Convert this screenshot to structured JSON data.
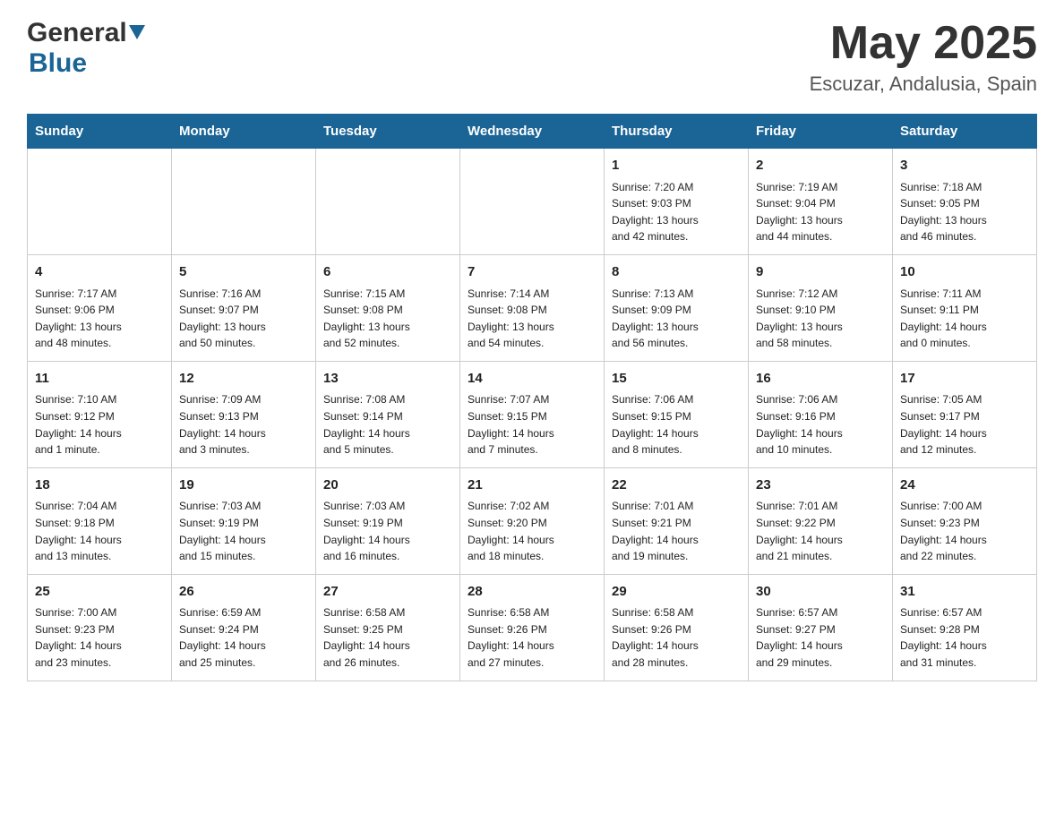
{
  "header": {
    "month_year": "May 2025",
    "location": "Escuzar, Andalusia, Spain",
    "logo_general": "General",
    "logo_blue": "Blue"
  },
  "days_of_week": [
    "Sunday",
    "Monday",
    "Tuesday",
    "Wednesday",
    "Thursday",
    "Friday",
    "Saturday"
  ],
  "weeks": [
    {
      "days": [
        {
          "num": "",
          "info": ""
        },
        {
          "num": "",
          "info": ""
        },
        {
          "num": "",
          "info": ""
        },
        {
          "num": "",
          "info": ""
        },
        {
          "num": "1",
          "info": "Sunrise: 7:20 AM\nSunset: 9:03 PM\nDaylight: 13 hours\nand 42 minutes."
        },
        {
          "num": "2",
          "info": "Sunrise: 7:19 AM\nSunset: 9:04 PM\nDaylight: 13 hours\nand 44 minutes."
        },
        {
          "num": "3",
          "info": "Sunrise: 7:18 AM\nSunset: 9:05 PM\nDaylight: 13 hours\nand 46 minutes."
        }
      ]
    },
    {
      "days": [
        {
          "num": "4",
          "info": "Sunrise: 7:17 AM\nSunset: 9:06 PM\nDaylight: 13 hours\nand 48 minutes."
        },
        {
          "num": "5",
          "info": "Sunrise: 7:16 AM\nSunset: 9:07 PM\nDaylight: 13 hours\nand 50 minutes."
        },
        {
          "num": "6",
          "info": "Sunrise: 7:15 AM\nSunset: 9:08 PM\nDaylight: 13 hours\nand 52 minutes."
        },
        {
          "num": "7",
          "info": "Sunrise: 7:14 AM\nSunset: 9:08 PM\nDaylight: 13 hours\nand 54 minutes."
        },
        {
          "num": "8",
          "info": "Sunrise: 7:13 AM\nSunset: 9:09 PM\nDaylight: 13 hours\nand 56 minutes."
        },
        {
          "num": "9",
          "info": "Sunrise: 7:12 AM\nSunset: 9:10 PM\nDaylight: 13 hours\nand 58 minutes."
        },
        {
          "num": "10",
          "info": "Sunrise: 7:11 AM\nSunset: 9:11 PM\nDaylight: 14 hours\nand 0 minutes."
        }
      ]
    },
    {
      "days": [
        {
          "num": "11",
          "info": "Sunrise: 7:10 AM\nSunset: 9:12 PM\nDaylight: 14 hours\nand 1 minute."
        },
        {
          "num": "12",
          "info": "Sunrise: 7:09 AM\nSunset: 9:13 PM\nDaylight: 14 hours\nand 3 minutes."
        },
        {
          "num": "13",
          "info": "Sunrise: 7:08 AM\nSunset: 9:14 PM\nDaylight: 14 hours\nand 5 minutes."
        },
        {
          "num": "14",
          "info": "Sunrise: 7:07 AM\nSunset: 9:15 PM\nDaylight: 14 hours\nand 7 minutes."
        },
        {
          "num": "15",
          "info": "Sunrise: 7:06 AM\nSunset: 9:15 PM\nDaylight: 14 hours\nand 8 minutes."
        },
        {
          "num": "16",
          "info": "Sunrise: 7:06 AM\nSunset: 9:16 PM\nDaylight: 14 hours\nand 10 minutes."
        },
        {
          "num": "17",
          "info": "Sunrise: 7:05 AM\nSunset: 9:17 PM\nDaylight: 14 hours\nand 12 minutes."
        }
      ]
    },
    {
      "days": [
        {
          "num": "18",
          "info": "Sunrise: 7:04 AM\nSunset: 9:18 PM\nDaylight: 14 hours\nand 13 minutes."
        },
        {
          "num": "19",
          "info": "Sunrise: 7:03 AM\nSunset: 9:19 PM\nDaylight: 14 hours\nand 15 minutes."
        },
        {
          "num": "20",
          "info": "Sunrise: 7:03 AM\nSunset: 9:19 PM\nDaylight: 14 hours\nand 16 minutes."
        },
        {
          "num": "21",
          "info": "Sunrise: 7:02 AM\nSunset: 9:20 PM\nDaylight: 14 hours\nand 18 minutes."
        },
        {
          "num": "22",
          "info": "Sunrise: 7:01 AM\nSunset: 9:21 PM\nDaylight: 14 hours\nand 19 minutes."
        },
        {
          "num": "23",
          "info": "Sunrise: 7:01 AM\nSunset: 9:22 PM\nDaylight: 14 hours\nand 21 minutes."
        },
        {
          "num": "24",
          "info": "Sunrise: 7:00 AM\nSunset: 9:23 PM\nDaylight: 14 hours\nand 22 minutes."
        }
      ]
    },
    {
      "days": [
        {
          "num": "25",
          "info": "Sunrise: 7:00 AM\nSunset: 9:23 PM\nDaylight: 14 hours\nand 23 minutes."
        },
        {
          "num": "26",
          "info": "Sunrise: 6:59 AM\nSunset: 9:24 PM\nDaylight: 14 hours\nand 25 minutes."
        },
        {
          "num": "27",
          "info": "Sunrise: 6:58 AM\nSunset: 9:25 PM\nDaylight: 14 hours\nand 26 minutes."
        },
        {
          "num": "28",
          "info": "Sunrise: 6:58 AM\nSunset: 9:26 PM\nDaylight: 14 hours\nand 27 minutes."
        },
        {
          "num": "29",
          "info": "Sunrise: 6:58 AM\nSunset: 9:26 PM\nDaylight: 14 hours\nand 28 minutes."
        },
        {
          "num": "30",
          "info": "Sunrise: 6:57 AM\nSunset: 9:27 PM\nDaylight: 14 hours\nand 29 minutes."
        },
        {
          "num": "31",
          "info": "Sunrise: 6:57 AM\nSunset: 9:28 PM\nDaylight: 14 hours\nand 31 minutes."
        }
      ]
    }
  ]
}
